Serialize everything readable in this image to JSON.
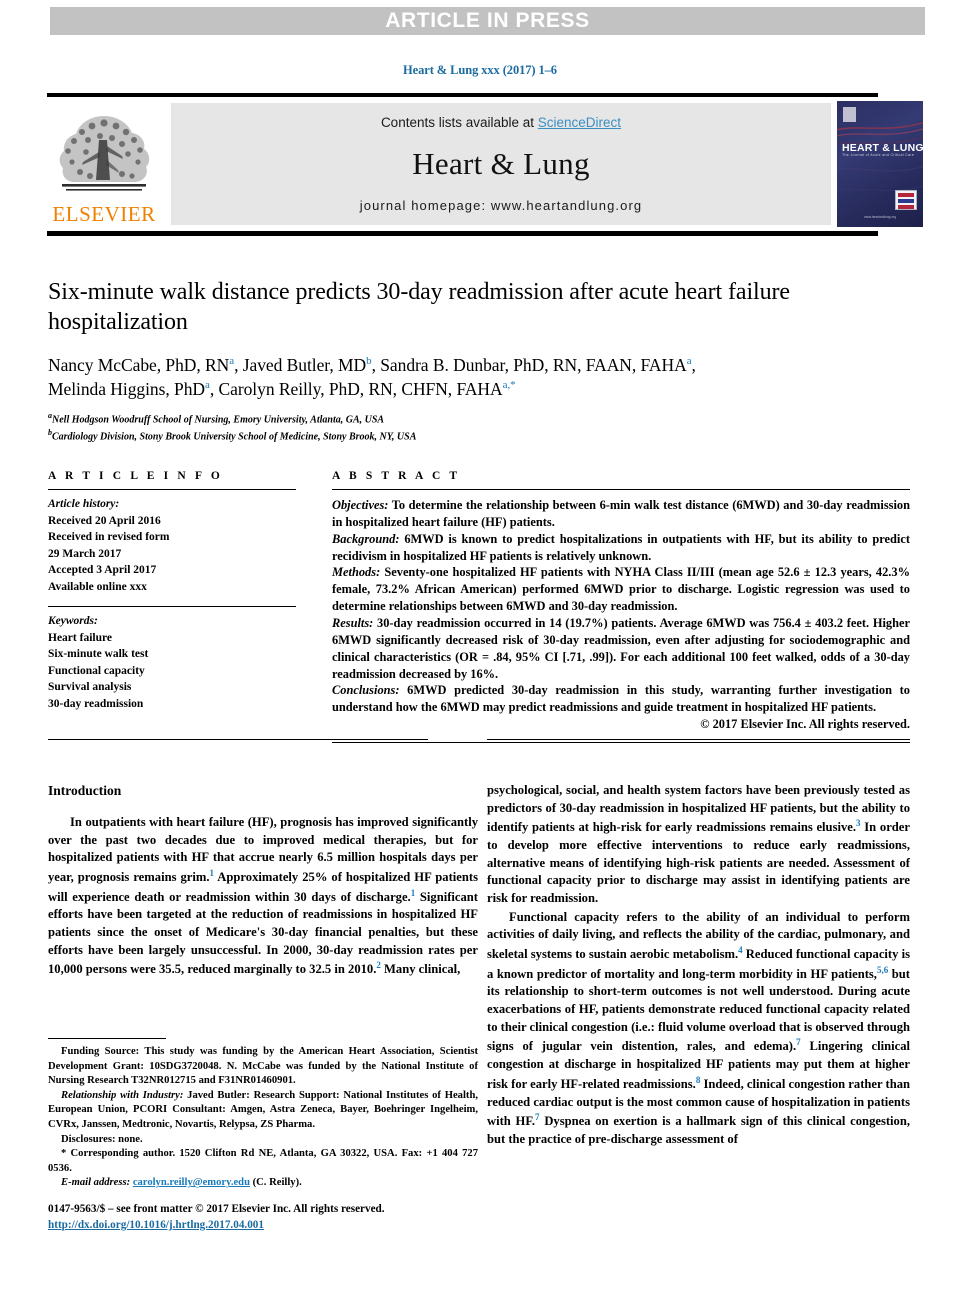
{
  "banner": {
    "text": "ARTICLE IN PRESS"
  },
  "running_head": "Heart & Lung xxx (2017) 1–6",
  "masthead": {
    "contents_prefix": "Contents lists available at ",
    "sciencedirect": "ScienceDirect",
    "journal_title": "Heart & Lung",
    "homepage": "journal homepage: www.heartandlung.org",
    "publisher_wordmark": "ELSEVIER",
    "cover": {
      "title": "HEART & LUNG",
      "subtitle": "The Journal of Acute and Critical Care",
      "footer": "www.heartandlung.org"
    },
    "accent_link_color": "#3a8fc4",
    "panel_color": "#e6e6e6",
    "elsevier_orange": "#f08000"
  },
  "article": {
    "title": "Six-minute walk distance predicts 30-day readmission after acute heart failure hospitalization",
    "authors_line1": "Nancy McCabe, PhD, RN",
    "authors_line1b": ", Javed Butler, MD",
    "authors_line1c": ", Sandra B. Dunbar, PhD, RN, FAAN, FAHA",
    "authors_line2": "Melinda Higgins, PhD",
    "authors_line2b": ", Carolyn Reilly, PhD, RN, CHFN, FAHA",
    "affiliation_a": "Nell Hodgson Woodruff School of Nursing, Emory University, Atlanta, GA, USA",
    "affiliation_b": "Cardiology Division, Stony Brook University School of Medicine, Stony Brook, NY, USA",
    "marker_a": "a",
    "marker_b": "b",
    "marker_corresponding": "a,*"
  },
  "article_info": {
    "heading": "A R T I C L E   I N F O",
    "history_label": "Article history:",
    "history": [
      "Received 20 April 2016",
      "Received in revised form",
      "29 March 2017",
      "Accepted 3 April 2017",
      "Available online xxx"
    ],
    "keywords_label": "Keywords:",
    "keywords": [
      "Heart failure",
      "Six-minute walk test",
      "Functional capacity",
      "Survival analysis",
      "30-day readmission"
    ]
  },
  "abstract": {
    "heading": "A B S T R A C T",
    "objectives_label": "Objectives:",
    "objectives": " To determine the relationship between 6-min walk test distance (6MWD) and 30-day readmission in hospitalized heart failure (HF) patients.",
    "background_label": "Background:",
    "background": " 6MWD is known to predict hospitalizations in outpatients with HF, but its ability to predict recidivism in hospitalized HF patients is relatively unknown.",
    "methods_label": "Methods:",
    "methods": " Seventy-one hospitalized HF patients with NYHA Class II/III (mean age 52.6 ± 12.3 years, 42.3% female, 73.2% African American) performed 6MWD prior to discharge. Logistic regression was used to determine relationships between 6MWD and 30-day readmission.",
    "results_label": "Results:",
    "results": " 30-day readmission occurred in 14 (19.7%) patients. Average 6MWD was 756.4 ± 403.2 feet. Higher 6MWD significantly decreased risk of 30-day readmission, even after adjusting for sociodemographic and clinical characteristics (OR = .84, 95% CI [.71, .99]). For each additional 100 feet walked, odds of a 30-day readmission decreased by 16%.",
    "conclusions_label": "Conclusions:",
    "conclusions": " 6MWD predicted 30-day readmission in this study, warranting further investigation to understand how the 6MWD may predict readmissions and guide treatment in hospitalized HF patients.",
    "copyright": "© 2017 Elsevier Inc. All rights reserved."
  },
  "body": {
    "intro_heading": "Introduction",
    "left_p1_a": "In outpatients with heart failure (HF), prognosis has improved significantly over the past two decades due to improved medical therapies, but for hospitalized patients with HF that accrue nearly 6.5 million hospitals days per year, prognosis remains grim.",
    "left_p1_ref1": "1",
    "left_p1_b": " Approximately 25% of hospitalized HF patients will experience death or readmission within 30 days of discharge.",
    "left_p1_ref2": "1",
    "left_p1_c": " Significant efforts have been targeted at the reduction of readmissions in hospitalized HF patients since the onset of Medicare's 30-day financial penalties, but these efforts have been largely unsuccessful. In 2000, 30-day readmission rates per 10,000 persons were 35.5, reduced marginally to 32.5 in 2010.",
    "left_p1_ref3": "2",
    "left_p1_d": " Many clinical,",
    "right_p1_a": "psychological, social, and health system factors have been previously tested as predictors of 30-day readmission in hospitalized HF patients, but the ability to identify patients at high-risk for early readmissions remains elusive.",
    "right_p1_ref1": "3",
    "right_p1_b": " In order to develop more effective interventions to reduce early readmissions, alternative means of identifying high-risk patients are needed. Assessment of functional capacity prior to discharge may assist in identifying patients are risk for readmission.",
    "right_p2_a": "Functional capacity refers to the ability of an individual to perform activities of daily living, and reflects the ability of the cardiac, pulmonary, and skeletal systems to sustain aerobic metabolism.",
    "right_p2_ref1": "4",
    "right_p2_b": " Reduced functional capacity is a known predictor of mortality and long-term morbidity in HF patients,",
    "right_p2_ref2": "5,6",
    "right_p2_c": " but its relationship to short-term outcomes is not well understood. During acute exacerbations of HF, patients demonstrate reduced functional capacity related to their clinical congestion (i.e.: fluid volume overload that is observed through signs of jugular vein distention, rales, and edema).",
    "right_p2_ref3": "7",
    "right_p2_d": " Lingering clinical congestion at discharge in hospitalized HF patients may put them at higher risk for early HF-related readmissions.",
    "right_p2_ref4": "8",
    "right_p2_e": " Indeed, clinical congestion rather than reduced cardiac output is the most common cause of hospitalization in patients with HF.",
    "right_p2_ref5": "7",
    "right_p2_f": " Dyspnea on exertion is a hallmark sign of this clinical congestion, but the practice of pre-discharge assessment of"
  },
  "footnotes": {
    "funding": "Funding Source: This study was funding by the American Heart Association, Scientist Development Grant: 10SDG3720048. N. McCabe was funded by the National Institute of Nursing Research T32NR012715 and F31NR01460901.",
    "industry_label": "Relationship with Industry:",
    "industry_author": " Javed Butler:",
    "industry_body": " Research Support: National Institutes of Health, European Union, PCORI Consultant: Amgen, Astra Zeneca, Bayer, Boehringer Ingelheim, CVRx, Janssen, Medtronic, Novartis, Relypsa, ZS Pharma.",
    "disclosures": "Disclosures: none.",
    "corresponding": "* Corresponding author. 1520 Clifton Rd NE, Atlanta, GA 30322, USA. Fax: +1 404 727 0536.",
    "email_label": "E-mail address:",
    "email": "carolyn.reilly@emory.edu",
    "email_suffix": " (C. Reilly)."
  },
  "imprint": {
    "issn_line": "0147-9563/$ – see front matter © 2017 Elsevier Inc. All rights reserved.",
    "doi": "http://dx.doi.org/10.1016/j.hrtlng.2017.04.001"
  }
}
